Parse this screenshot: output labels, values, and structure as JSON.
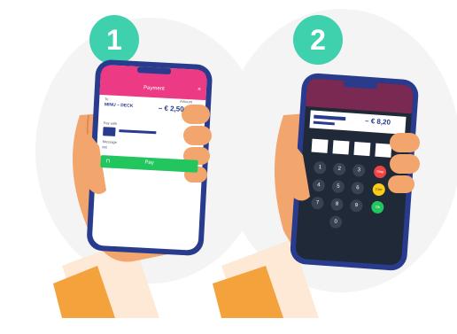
{
  "steps": [
    {
      "number": "1"
    },
    {
      "number": "2"
    }
  ],
  "phone1": {
    "header_title": "Payment",
    "to_label": "To",
    "merchant_name": "MINU – DECK",
    "amount_label": "Amount",
    "amount": "– € 2,50",
    "pay_with_label": "Pay with",
    "message_label": "Message",
    "message_value": "est",
    "pay_button": "Pay"
  },
  "phone2": {
    "amount": "– € 8,20",
    "keypad": [
      "1",
      "2",
      "3",
      "4",
      "5",
      "6",
      "7",
      "8",
      "9",
      "0"
    ],
    "stop_label": "Stop",
    "correction_label": "Corr",
    "ok_label": "Ok"
  },
  "colors": {
    "badge": "#3fd0ae",
    "phone1_header": "#ec3a84",
    "pay_button": "#22c55e",
    "phone_frame": "#283b8c",
    "stop_key": "#ef4444",
    "correction_key": "#facc15",
    "ok_key": "#22c55e"
  }
}
